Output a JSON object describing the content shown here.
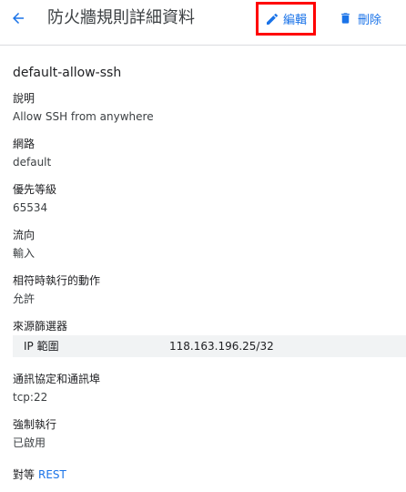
{
  "header": {
    "title": "防火牆規則詳細資料",
    "edit_label": "編輯",
    "delete_label": "刪除",
    "accent_color": "#1a73e8",
    "highlight_color": "#ff0000"
  },
  "rule": {
    "name": "default-allow-ssh",
    "fields": [
      {
        "label": "說明",
        "value": "Allow SSH from anywhere"
      },
      {
        "label": "網路",
        "value": "default"
      },
      {
        "label": "優先等級",
        "value": "65534"
      },
      {
        "label": "流向",
        "value": "輸入"
      },
      {
        "label": "相符時執行的動作",
        "value": "允許"
      },
      {
        "label": "來源篩選器"
      },
      {
        "label": "通訊協定和通訊埠",
        "value": "tcp:22"
      },
      {
        "label": "強制執行",
        "value": "已啟用"
      }
    ],
    "source_filter": {
      "key": "IP 範圍",
      "value": "118.163.196.25/32"
    }
  },
  "footer": {
    "equivalent_label": "對等",
    "rest_link": "REST"
  }
}
